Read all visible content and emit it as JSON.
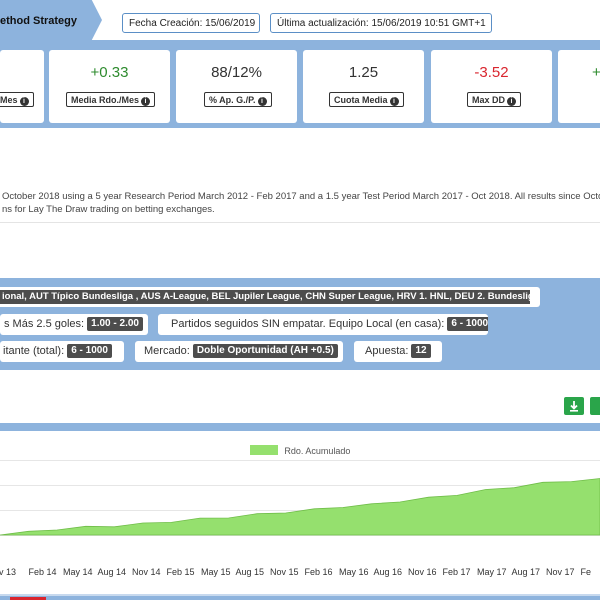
{
  "header": {
    "title": "ethod Strategy",
    "fecha_creacion": "Fecha Creación: 15/06/2019",
    "ultima_actualizacion": "Última actualización: 15/06/2019 10:51 GMT+1"
  },
  "stats": [
    {
      "value": "",
      "label": "Mes",
      "color": "#333333"
    },
    {
      "value": "+0.33",
      "label": "Media Rdo./Mes",
      "color": "#2e8b2e"
    },
    {
      "value": "88/12%",
      "label": "% Ap. G./P.",
      "color": "#333333"
    },
    {
      "value": "1.25",
      "label": "Cuota Media",
      "color": "#333333"
    },
    {
      "value": "-3.52",
      "label": "Max DD",
      "color": "#d9262f"
    },
    {
      "value": "+",
      "label": "",
      "color": "#2e8b2e"
    }
  ],
  "description": {
    "line1": "October 2018 using a 5 year Research Period March 2012 - Feb 2017 and a 1.5 year Test Period March 2017 - Oct 2018. All results since Octo",
    "line2": "ns for Lay The Draw trading on betting exchanges."
  },
  "filters": {
    "leagues": "ional, AUT Típico Bundesliga , AUS A-League, BEL Jupiler League, CHN Super League, HRV 1. HNL, DEU 2. Bundesliga ...",
    "mas25_label": "s Más 2.5 goles:",
    "mas25_value": "1.00 - 2.00",
    "partidos_label": "Partidos seguidos SIN empatar. Equipo Local (en casa):",
    "partidos_value": "6 - 1000",
    "visitante_label": "itante (total):",
    "visitante_value": "6 - 1000",
    "mercado_label": "Mercado:",
    "mercado_value": "Doble Oportunidad (AH +0.5)",
    "apuesta_label": "Apuesta:",
    "apuesta_value": "12"
  },
  "chart_data": {
    "type": "area",
    "legend": [
      "Rdo. Acumulado"
    ],
    "x_tick_labels": [
      "ov 13",
      "Feb 14",
      "May 14",
      "Aug 14",
      "Nov 14",
      "Feb 15",
      "May 15",
      "Aug 15",
      "Nov 15",
      "Feb 16",
      "May 16",
      "Aug 16",
      "Nov 16",
      "Feb 17",
      "May 17",
      "Aug 17",
      "Nov 17",
      "Fe"
    ],
    "series": [
      {
        "name": "Rdo. Acumulado",
        "color": "#95e06e",
        "values": [
          0.0,
          0.04,
          0.09,
          0.13,
          0.15,
          0.19,
          0.23,
          0.28,
          0.31,
          0.36,
          0.4,
          0.45,
          0.5,
          0.54,
          0.6,
          0.66,
          0.72,
          0.8,
          0.86,
          0.93,
          0.97,
          1.0
        ]
      }
    ]
  }
}
